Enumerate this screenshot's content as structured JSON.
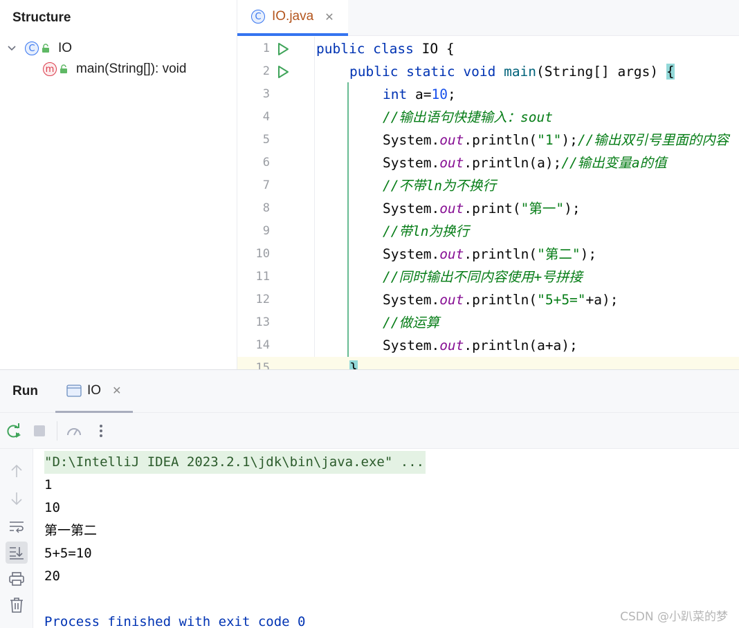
{
  "structure": {
    "title": "Structure",
    "class_item": "IO",
    "method_item": "main(String[]): void"
  },
  "editor": {
    "tab_label": "IO.java",
    "lines": [
      {
        "n": "1",
        "run": true
      },
      {
        "n": "2",
        "run": true
      },
      {
        "n": "3"
      },
      {
        "n": "4"
      },
      {
        "n": "5"
      },
      {
        "n": "6"
      },
      {
        "n": "7"
      },
      {
        "n": "8"
      },
      {
        "n": "9"
      },
      {
        "n": "10"
      },
      {
        "n": "11"
      },
      {
        "n": "12"
      },
      {
        "n": "13"
      },
      {
        "n": "14"
      },
      {
        "n": "15"
      }
    ]
  },
  "run": {
    "title": "Run",
    "tab_label": "IO",
    "console": {
      "command": "\"D:\\IntelliJ IDEA 2023.2.1\\jdk\\bin\\java.exe\" ...",
      "output": [
        "1",
        "10",
        "第一第二",
        "5+5=10",
        "20"
      ],
      "exit": "Process finished with exit code 0"
    }
  },
  "watermark": "CSDN @小趴菜的梦",
  "colors": {
    "accent": "#3574f0",
    "keyword": "#0033b3",
    "string": "#067d17",
    "number": "#1750eb",
    "field": "#871094",
    "run_green": "#3fa45a"
  }
}
